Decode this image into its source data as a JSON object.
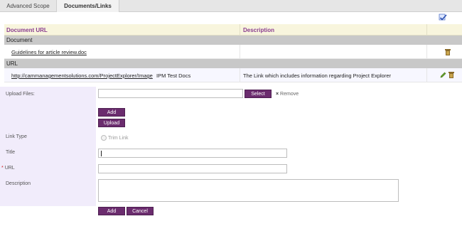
{
  "tabs": [
    {
      "label": "Advanced Scope"
    },
    {
      "label": "Documents/Links"
    }
  ],
  "icons": {
    "approve": "checkmark-icon",
    "delete": "trash-icon",
    "edit": "pencil-icon"
  },
  "grid": {
    "columns": {
      "url": "Document URL",
      "description": "Description"
    },
    "groups": [
      {
        "name": "Document",
        "rows": [
          {
            "url": "Guidelines for article review.doc",
            "name": "",
            "description": ""
          }
        ]
      },
      {
        "name": "URL",
        "rows": [
          {
            "url": "http://cammanagementsolutions.com/ProjectExplorer/Image",
            "name": "IPM Test Docs",
            "description": "The Link which includes information regarding Project Explorer"
          }
        ]
      }
    ]
  },
  "form": {
    "upload_label": "Upload Files:",
    "select_label": "Select",
    "remove_label": "Remove",
    "add_label": "Add",
    "upload_button": "Upload",
    "link_type_label": "Link Type",
    "trim_link_label": "Trim Link",
    "title_label": "Title",
    "title_value": "",
    "url_required": "*",
    "url_label": "URL",
    "url_value": "",
    "description_label": "Description",
    "description_value": "",
    "submit_add": "Add",
    "submit_cancel": "Cancel"
  },
  "colors": {
    "accent": "#6b2c6e",
    "header_text": "#8a3d8f",
    "form_panel": "#f1ecfb"
  }
}
